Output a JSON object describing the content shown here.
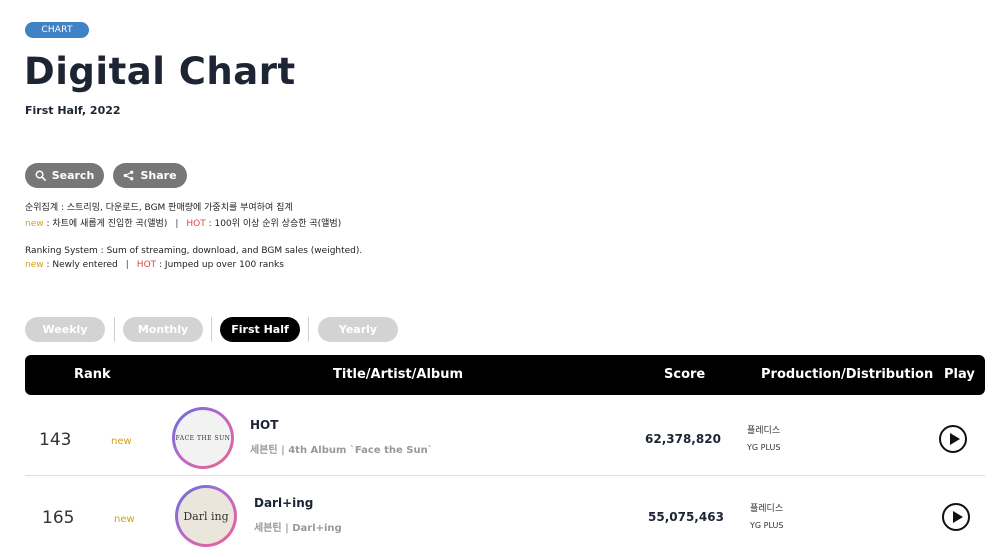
{
  "header": {
    "badge": "CHART",
    "title": "Digital Chart",
    "subtitle": "First Half, 2022"
  },
  "actions": {
    "search_label": "Search",
    "share_label": "Share"
  },
  "description": {
    "kr_line1": "순위집계 : 스트리밍, 다운로드, BGM 판매량에 가중치를 부여하여 집계",
    "kr_new_key": "new",
    "kr_new_text": " : 차트에 새롭게 진입한 곡(앨범)",
    "kr_sep": "|",
    "kr_hot_key": "HOT",
    "kr_hot_text": " : 100위 이상 순위 상승한 곡(앨범)",
    "en_line1": "Ranking System : Sum of streaming, download, and BGM sales (weighted).",
    "en_new_key": "new",
    "en_new_text": " : Newly entered",
    "en_sep": "|",
    "en_hot_key": "HOT",
    "en_hot_text": " : Jumped up over 100 ranks"
  },
  "tabs": [
    {
      "label": "Weekly",
      "active": false
    },
    {
      "label": "Monthly",
      "active": false
    },
    {
      "label": "First Half",
      "active": true
    },
    {
      "label": "Yearly",
      "active": false
    }
  ],
  "table": {
    "columns": {
      "rank": "Rank",
      "title": "Title/Artist/Album",
      "score": "Score",
      "production": "Production/Distribution",
      "play": "Play"
    },
    "rows": [
      {
        "rank": "143",
        "status": "new",
        "title": "HOT",
        "subtitle": "세븐틴 | 4th Album `Face the Sun`",
        "art_text": "FACE THE SUN",
        "score": "62,378,820",
        "production": "플레디스",
        "distribution": "YG PLUS"
      },
      {
        "rank": "165",
        "status": "new",
        "title": "Darl+ing",
        "subtitle": "세븐틴 | Darl+ing",
        "art_text": "Darl ing",
        "score": "55,075,463",
        "production": "플레디스",
        "distribution": "YG PLUS"
      }
    ]
  },
  "colors": {
    "badge": "#3f83c6",
    "new": "#d4a017",
    "hot": "#e04646",
    "header_bg": "#000000"
  }
}
